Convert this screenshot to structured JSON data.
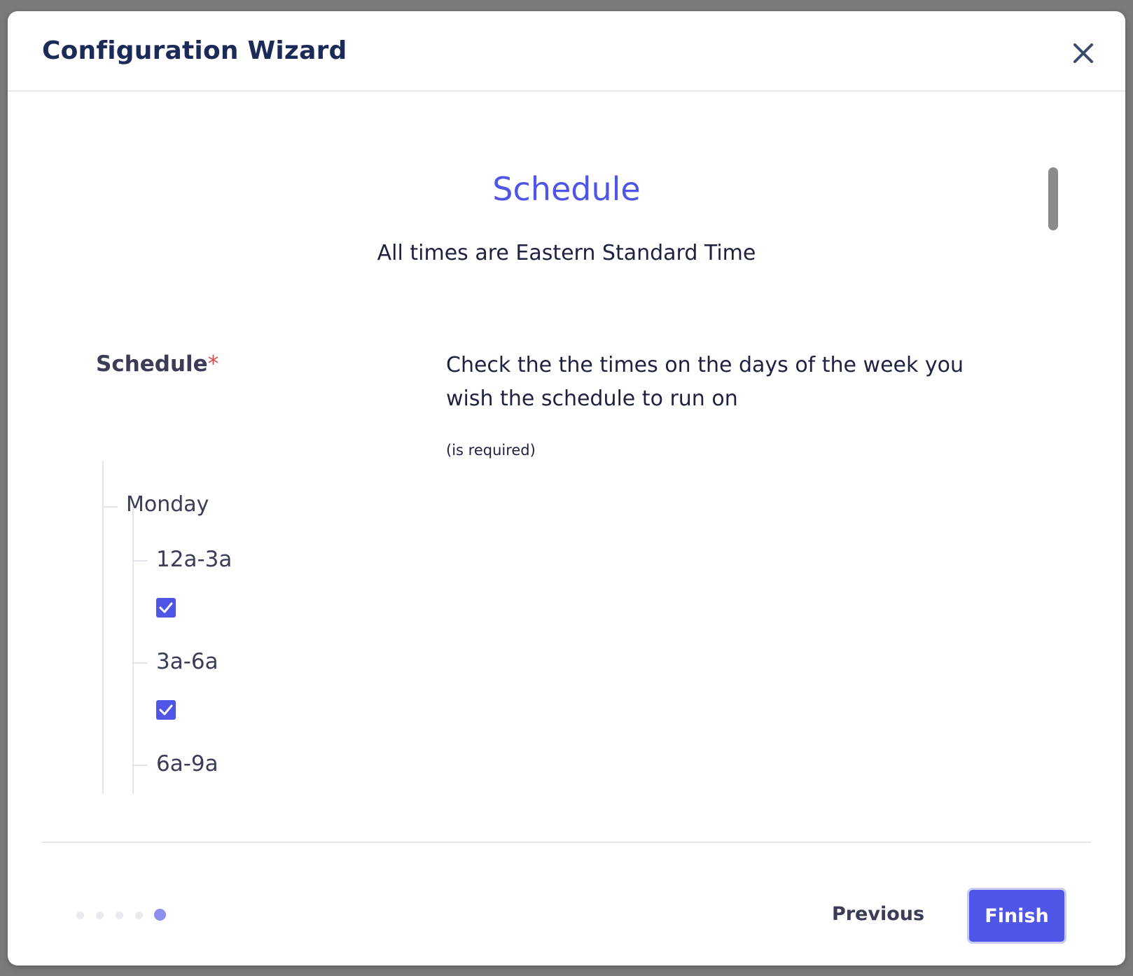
{
  "dialog": {
    "title": "Configuration Wizard",
    "close_icon": "close-icon"
  },
  "step": {
    "title": "Schedule",
    "subtitle": "All times are Eastern Standard Time"
  },
  "field": {
    "label": "Schedule",
    "required_marker": "*",
    "description": "Check the the times on the days of the week you wish the schedule to run on",
    "hint": "(is required)"
  },
  "schedule": {
    "day": "Monday",
    "slots": [
      {
        "label": "12a-3a",
        "checked": true
      },
      {
        "label": "3a-6a",
        "checked": true
      },
      {
        "label": "6a-9a"
      }
    ]
  },
  "pagination": {
    "total_steps": 5,
    "current_step": 5
  },
  "footer": {
    "previous_label": "Previous",
    "finish_label": "Finish"
  },
  "colors": {
    "accent": "#4f55e6",
    "title_text": "#1b2a56",
    "required": "#d64a4a",
    "active_dot": "#8d90ee"
  }
}
